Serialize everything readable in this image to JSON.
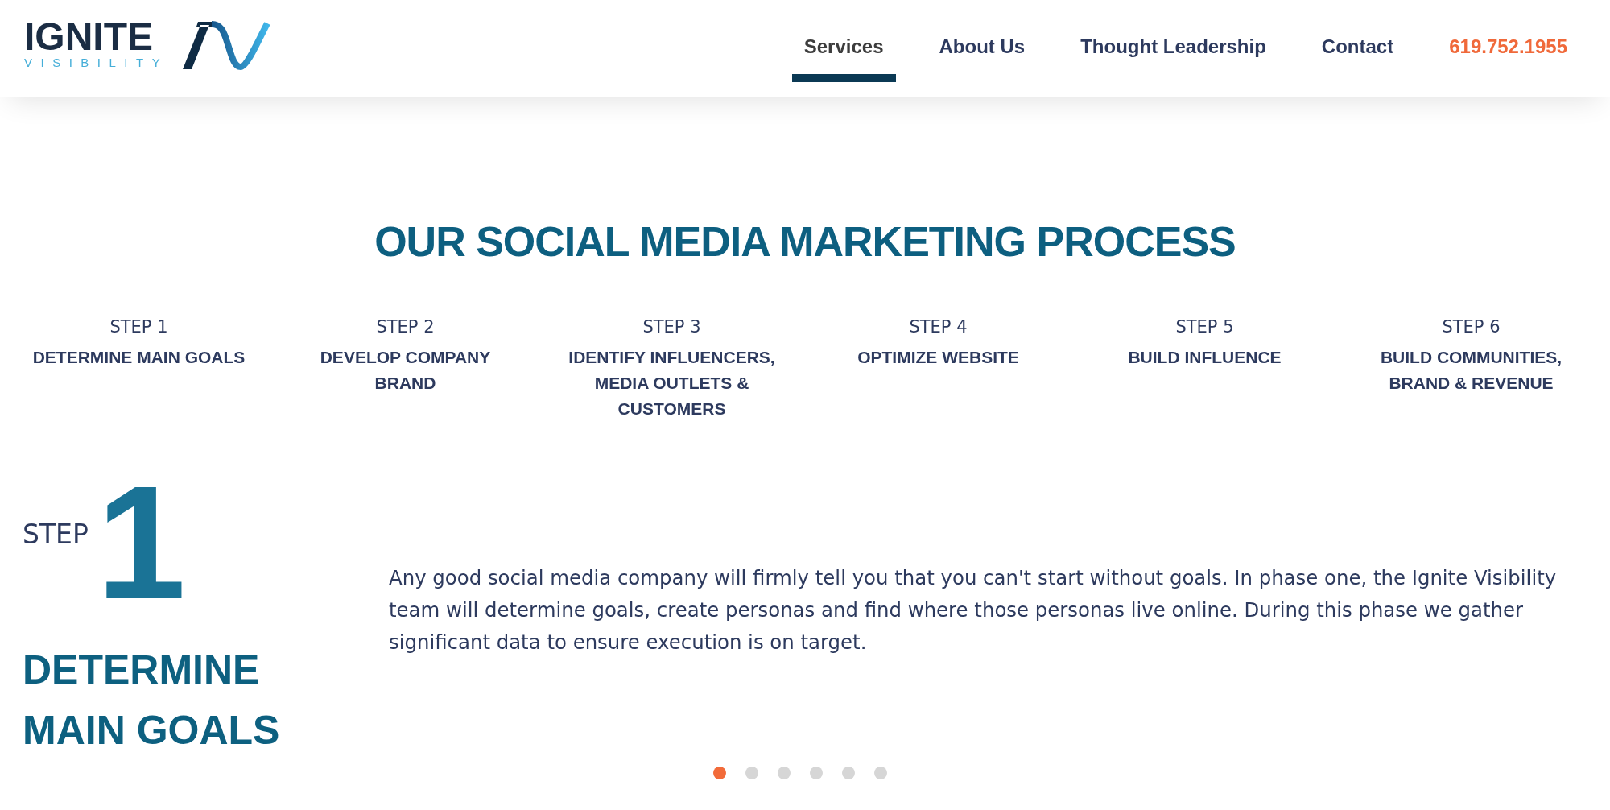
{
  "header": {
    "logo": {
      "wordmark": "IGNITE",
      "tagline": "VISIBILITY"
    },
    "nav": [
      {
        "label": "Services",
        "selected": true
      },
      {
        "label": "About Us",
        "selected": false
      },
      {
        "label": "Thought Leadership",
        "selected": false
      },
      {
        "label": "Contact",
        "selected": false
      }
    ],
    "phone": "619.752.1955"
  },
  "process": {
    "title": "OUR SOCIAL MEDIA MARKETING PROCESS",
    "steps": [
      {
        "number": "STEP 1",
        "title": "DETERMINE MAIN GOALS"
      },
      {
        "number": "STEP 2",
        "title": "DEVELOP COMPANY BRAND"
      },
      {
        "number": "STEP 3",
        "title": "IDENTIFY INFLUENCERS, MEDIA OUTLETS & CUSTOMERS"
      },
      {
        "number": "STEP 4",
        "title": "OPTIMIZE WEBSITE"
      },
      {
        "number": "STEP 5",
        "title": "BUILD INFLUENCE"
      },
      {
        "number": "STEP 6",
        "title": "BUILD COMMUNITIES, BRAND & REVENUE"
      }
    ]
  },
  "slide": {
    "step_label": "STEP",
    "step_number": "1",
    "title": "DETERMINE MAIN GOALS",
    "description": "Any good social media company will firmly tell you that you can't start without goals. In phase one, the Ignite Visibility team will determine goals, create personas and find where those personas live online. During this phase we gather significant data to ensure execution is on target."
  },
  "dots": [
    {
      "selected": true
    },
    {
      "selected": false
    },
    {
      "selected": false
    },
    {
      "selected": false
    },
    {
      "selected": false
    },
    {
      "selected": false
    }
  ]
}
